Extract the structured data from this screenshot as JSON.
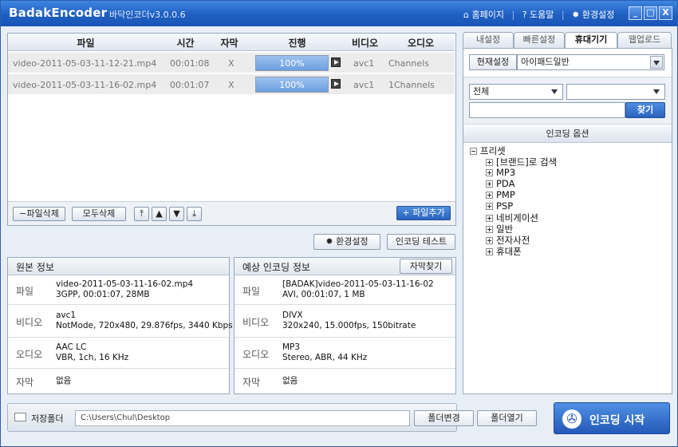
{
  "title_bar": {
    "app_name": "BadakEncoder",
    "app_subtitle": "바닥인코더v3.0.0.6",
    "links": {
      "homepage": "홈페이지",
      "help": "도움말",
      "settings": "환경설정"
    },
    "window_buttons": {
      "minimize": "_",
      "maximize": "□",
      "close": "X"
    }
  },
  "file_table": {
    "headers": {
      "file": "파일",
      "time": "시간",
      "subtitle": "자막",
      "progress": "진행",
      "video": "비디오",
      "audio": "오디오"
    },
    "rows": [
      {
        "file": "video-2011-05-03-11-12-21.mp4",
        "time": "00:01:08",
        "subtitle": "X",
        "progress_pct": "100%",
        "progress_value": 100,
        "video": "avc1",
        "audio": "Channels"
      },
      {
        "file": "video-2011-05-03-11-16-02.mp4",
        "time": "00:01:07",
        "subtitle": "X",
        "progress_pct": "100%",
        "progress_value": 100,
        "video": "avc1",
        "audio": "1Channels"
      }
    ],
    "buttons": {
      "delete_file": "−파일삭제",
      "delete_all": "모두삭제",
      "add_file": "+ 파일추가"
    }
  },
  "actions": {
    "settings": "환경설정",
    "encoding_test": "인코딩 테스트"
  },
  "source_info": {
    "title": "원본 정보",
    "rows": [
      {
        "label": "파일",
        "line1": "video-2011-05-03-11-16-02.mp4",
        "line2": "3GPP, 00:01:07, 28MB"
      },
      {
        "label": "비디오",
        "line1": "avc1",
        "line2": "NotMode, 720x480, 29.876fps, 3440 Kbps"
      },
      {
        "label": "오디오",
        "line1": "AAC LC",
        "line2": "VBR, 1ch, 16 KHz"
      },
      {
        "label": "자막",
        "line1": "없음",
        "line2": ""
      }
    ]
  },
  "expected_info": {
    "title": "예상 인코딩 정보",
    "find_subtitle": "자막찾기",
    "rows": [
      {
        "label": "파일",
        "line1": "[BADAK]video-2011-05-03-11-16-02",
        "line2": "AVI, 00:01:07, 1 MB"
      },
      {
        "label": "비디오",
        "line1": "DIVX",
        "line2": "320x240, 15.000fps, 150bitrate"
      },
      {
        "label": "오디오",
        "line1": "MP3",
        "line2": "Stereo, ABR, 44 KHz"
      },
      {
        "label": "자막",
        "line1": "없음",
        "line2": ""
      }
    ]
  },
  "right_panel": {
    "tabs": [
      "내설정",
      "빠른설정",
      "휴대기기",
      "웹업로드"
    ],
    "active_tab": 2,
    "current_label": "현재설정",
    "current_value": "아이패드일반",
    "filter1": "전체",
    "filter2": "",
    "search_value": "",
    "search_button": "찾기",
    "options_title": "인코딩 옵션",
    "tree_root": "프리셋",
    "tree_items": [
      "[브랜드]로 검색",
      "MP3",
      "PDA",
      "PMP",
      "PSP",
      "네비게이션",
      "일반",
      "전자사전",
      "휴대폰"
    ]
  },
  "bottom_bar": {
    "save_folder_label": "저장폴더",
    "path": "C:\\Users\\Chul\\Desktop",
    "change_folder": "폴더변경",
    "open_folder": "폴더열기",
    "start_encoding": "인코딩 시작"
  },
  "colors": {
    "title_blue": "#1f5fc2",
    "accent_blue": "#2a63bf",
    "progress_fill": "#6b9ee0"
  }
}
